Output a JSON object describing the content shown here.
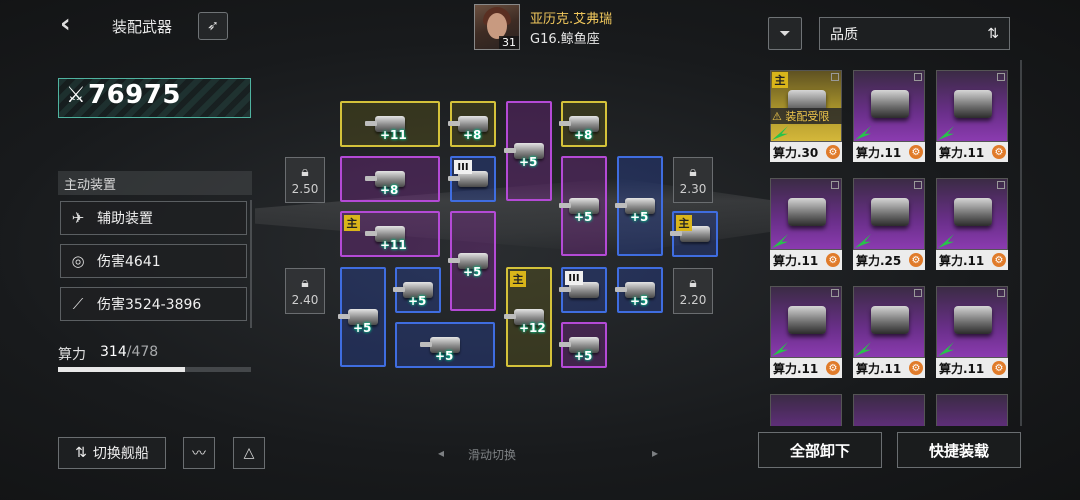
{
  "header": {
    "title": "装配武器",
    "back_icon": "chevron-left-icon",
    "rocket_icon": "rocket-icon"
  },
  "pilot": {
    "name": "亚历克.艾弗瑞",
    "class": "G16.鲸鱼座",
    "level": "31"
  },
  "power": {
    "value": "76975",
    "icon": "crossed-swords-icon"
  },
  "active_panel": {
    "title": "主动装置",
    "rows": [
      {
        "icon": "fighter-icon",
        "label": "辅助装置"
      },
      {
        "icon": "target-icon",
        "label": "伤害4641"
      },
      {
        "icon": "claw-icon",
        "label": "伤害3524-3896"
      }
    ]
  },
  "compute": {
    "label": "算力",
    "current": "314",
    "max": "/478",
    "fill_fraction": 0.657
  },
  "bottom_left": {
    "switch_ship": "切换舰船",
    "switch_icon": "swap-icon"
  },
  "swipe_hint": "滑动切换",
  "locks": [
    {
      "value": "2.50"
    },
    {
      "value": "2.40"
    },
    {
      "value": "2.30"
    },
    {
      "value": "2.20"
    }
  ],
  "grid_slots": [
    {
      "color": "y",
      "level": "+11"
    },
    {
      "color": "y",
      "level": "+8"
    },
    {
      "color": "p",
      "level": "+5"
    },
    {
      "color": "y",
      "level": "+8"
    },
    {
      "color": "p",
      "level": "+8"
    },
    {
      "color": "b",
      "level": "",
      "roman": "III"
    },
    {
      "color": "p",
      "level": "+5"
    },
    {
      "color": "b",
      "level": "+5"
    },
    {
      "color": "p",
      "level": "+11",
      "main": "主"
    },
    {
      "color": "p",
      "level": "+5"
    },
    {
      "color": "b",
      "level": "",
      "main": "主"
    },
    {
      "color": "b",
      "level": "+5"
    },
    {
      "color": "b",
      "level": "+5"
    },
    {
      "color": "y",
      "level": "+12",
      "main": "主"
    },
    {
      "color": "b",
      "level": "",
      "roman": "III"
    },
    {
      "color": "b",
      "level": "+5"
    },
    {
      "color": "b",
      "level": "+5"
    },
    {
      "color": "p",
      "level": "+5"
    }
  ],
  "right_panel": {
    "quality_label": "品质",
    "filter_icon": "filter-icon",
    "sort_icon": "sort-icon",
    "main_tag": "主",
    "restricted": "装配受限",
    "cards": [
      {
        "label": "算力.30",
        "rarity": "gold"
      },
      {
        "label": "算力.11",
        "rarity": "purple"
      },
      {
        "label": "算力.11",
        "rarity": "purple"
      },
      {
        "label": "算力.11",
        "rarity": "purple"
      },
      {
        "label": "算力.25",
        "rarity": "purple"
      },
      {
        "label": "算力.11",
        "rarity": "purple"
      },
      {
        "label": "算力.11",
        "rarity": "purple"
      },
      {
        "label": "算力.11",
        "rarity": "purple"
      },
      {
        "label": "算力.11",
        "rarity": "purple"
      }
    ],
    "unequip_all": "全部卸下",
    "quick_equip": "快捷装载"
  },
  "colors": {
    "gold": "#f0c75c",
    "accent_teal": "#4fb3a0",
    "yellow_slot": "#d4c23a",
    "purple_slot": "#b44ad6",
    "blue_slot": "#3f6de0"
  }
}
